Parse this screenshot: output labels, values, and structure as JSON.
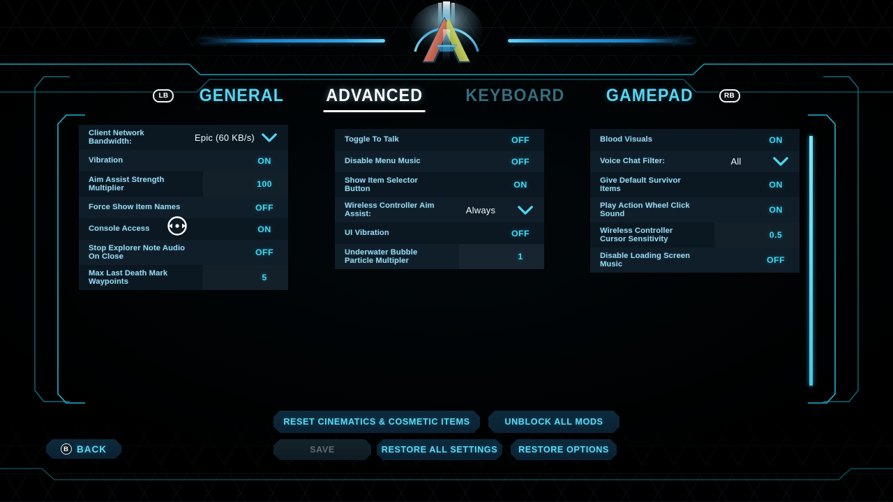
{
  "header": {
    "logo_alt": "ark-logo",
    "left_bumper": "LB",
    "right_bumper": "RB"
  },
  "tabs": [
    {
      "label": "GENERAL",
      "state": "norm"
    },
    {
      "label": "ADVANCED",
      "state": "active"
    },
    {
      "label": "KEYBOARD",
      "state": "dim"
    },
    {
      "label": "GAMEPAD",
      "state": "norm"
    }
  ],
  "columns": {
    "left": [
      {
        "label1": "Client Network",
        "label2": "Bandwidth:",
        "value": "Epic (60 KB/s)",
        "type": "dropdown"
      },
      {
        "label1": "Vibration",
        "label2": "",
        "value": "ON",
        "type": "toggle"
      },
      {
        "label1": "Aim Assist Strength",
        "label2": "Multiplier",
        "value": "100",
        "type": "slider"
      },
      {
        "label1": "Force Show Item Names",
        "label2": "",
        "value": "OFF",
        "type": "toggle"
      },
      {
        "label1": "Console Access",
        "label2": "",
        "value": "ON",
        "type": "toggle"
      },
      {
        "label1": "Stop Explorer Note Audio",
        "label2": "On Close",
        "value": "OFF",
        "type": "toggle"
      },
      {
        "label1": "Max Last Death Mark",
        "label2": "Waypoints",
        "value": "5",
        "type": "slider"
      }
    ],
    "middle": [
      {
        "label1": "Toggle To Talk",
        "label2": "",
        "value": "OFF",
        "type": "toggle"
      },
      {
        "label1": "Disable Menu Music",
        "label2": "",
        "value": "OFF",
        "type": "toggle"
      },
      {
        "label1": "Show Item Selector",
        "label2": "Button",
        "value": "ON",
        "type": "toggle"
      },
      {
        "label1": "Wireless Controller Aim",
        "label2": "Assist:",
        "value": "Always",
        "type": "dropdown"
      },
      {
        "label1": "UI Vibration",
        "label2": "",
        "value": "OFF",
        "type": "toggle"
      },
      {
        "label1": "Underwater Bubble",
        "label2": "Particle Multipler",
        "value": "1",
        "type": "slider"
      }
    ],
    "right": [
      {
        "label1": "Blood Visuals",
        "label2": "",
        "value": "ON",
        "type": "toggle"
      },
      {
        "label1": "Voice Chat Filter:",
        "label2": "",
        "value": "All",
        "type": "dropdown"
      },
      {
        "label1": "Give Default Survivor",
        "label2": "Items",
        "value": "ON",
        "type": "toggle"
      },
      {
        "label1": "Play Action Wheel Click",
        "label2": "Sound",
        "value": "ON",
        "type": "toggle"
      },
      {
        "label1": "Wireless Controller",
        "label2": "Cursor Sensitivity",
        "value": "0.5",
        "type": "slider"
      },
      {
        "label1": "Disable Loading Screen",
        "label2": "Music",
        "value": "OFF",
        "type": "toggle"
      }
    ]
  },
  "buttons": {
    "reset_cinematics": "RESET CINEMATICS & COSMETIC ITEMS",
    "unblock_all_mods": "UNBLOCK ALL MODS",
    "save": "SAVE",
    "restore_all_settings": "RESTORE ALL SETTINGS",
    "restore_options": "RESTORE OPTIONS",
    "back": "BACK",
    "back_glyph": "B"
  },
  "colors": {
    "accent_cyan": "#41d7f2",
    "label_blue": "#9fd9ef",
    "tab_active": "#ffffff",
    "tab_dim": "#356d7f",
    "panel_bg": "#0b1822",
    "panel_bg_alt": "#101e2a",
    "frame_line": "#18a0bd"
  }
}
